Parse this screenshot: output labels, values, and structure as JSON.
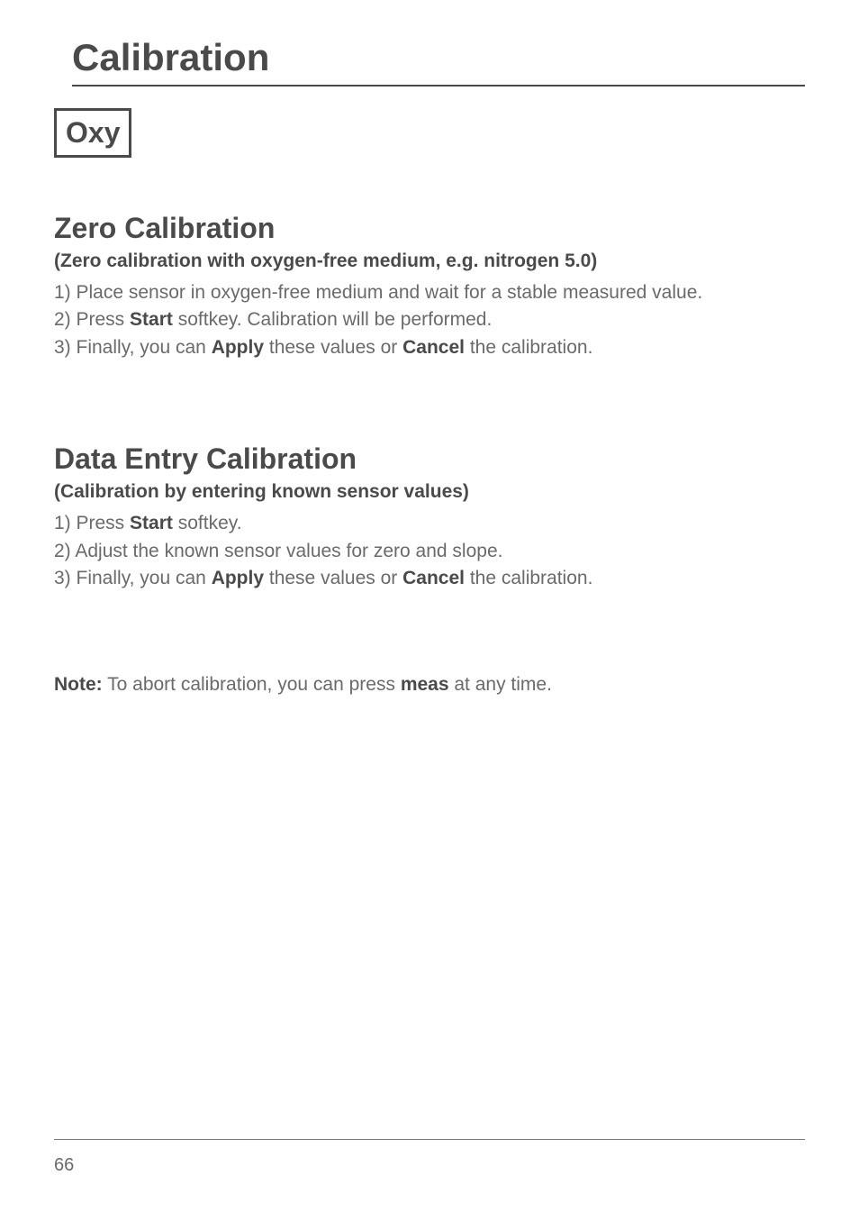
{
  "page": {
    "title": "Calibration",
    "badge": "Oxy",
    "page_number": "66"
  },
  "section1": {
    "heading": "Zero Calibration",
    "subheading": "(Zero calibration with oxygen-free medium, e.g. nitrogen 5.0)",
    "step1_prefix": "1) Place sensor in oxygen-free medium and wait for a stable measured value.",
    "step2_a": "2) Press ",
    "step2_b": "Start",
    "step2_c": " softkey. Calibration will be performed.",
    "step3_a": "3) Finally, you can ",
    "step3_b": "Apply",
    "step3_c": " these values or ",
    "step3_d": "Cancel",
    "step3_e": " the calibration."
  },
  "section2": {
    "heading": "Data Entry Calibration",
    "subheading": "(Calibration by entering known sensor values)",
    "step1_a": "1) Press ",
    "step1_b": "Start",
    "step1_c": " softkey.",
    "step2": "2) Adjust the known sensor values for zero and slope.",
    "step3_a": "3) Finally, you can ",
    "step3_b": "Apply",
    "step3_c": " these values or ",
    "step3_d": "Cancel",
    "step3_e": " the calibration."
  },
  "note": {
    "label": "Note:",
    "text_a": " To abort calibration, you can press ",
    "text_b": "meas",
    "text_c": " at any time."
  }
}
